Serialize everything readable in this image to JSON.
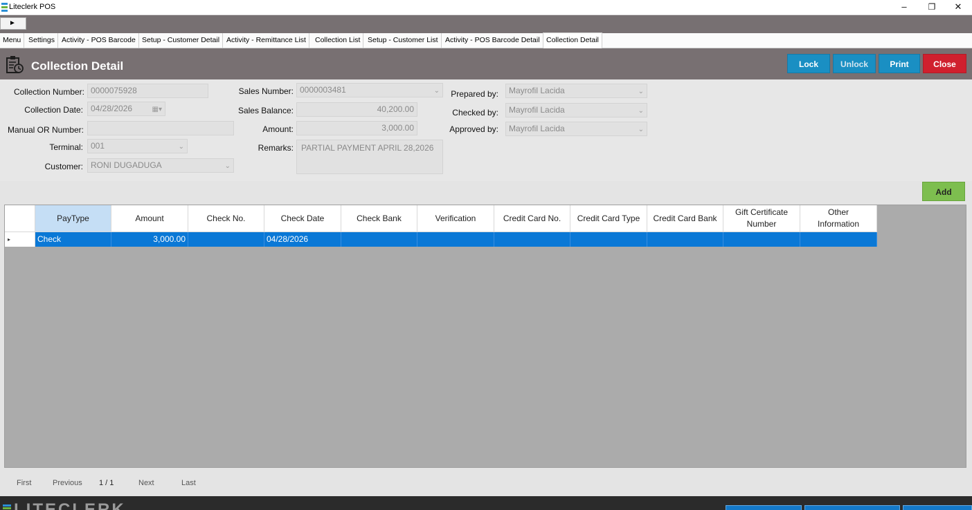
{
  "window": {
    "title": "Liteclerk POS",
    "minimize": "–",
    "restore": "❐",
    "close": "✕"
  },
  "menubar": {
    "toggle": "►"
  },
  "tabs": [
    "Menu",
    "Settings",
    "Activity - POS Barcode",
    "Setup - Customer Detail",
    "Activity - Remittance List",
    "Collection List",
    "Setup - Customer List",
    "Activity - POS Barcode Detail",
    "Collection Detail"
  ],
  "header": {
    "title": "Collection Detail",
    "lock": "Lock",
    "unlock": "Unlock",
    "print": "Print",
    "close": "Close"
  },
  "form": {
    "collection_number": {
      "label": "Collection Number:",
      "value": "0000075928"
    },
    "collection_date": {
      "label": "Collection Date:",
      "value": "04/28/2026"
    },
    "manual_or_number": {
      "label": "Manual OR Number:",
      "value": ""
    },
    "terminal": {
      "label": "Terminal:",
      "value": "001"
    },
    "customer": {
      "label": "Customer:",
      "value": "RONI DUGADUGA"
    },
    "sales_number": {
      "label": "Sales Number:",
      "value": "0000003481"
    },
    "sales_balance": {
      "label": "Sales Balance:",
      "value": "40,200.00"
    },
    "amount": {
      "label": "Amount:",
      "value": "3,000.00"
    },
    "remarks": {
      "label": "Remarks:",
      "value": "PARTIAL PAYMENT APRIL 28,2026"
    },
    "prepared_by": {
      "label": "Prepared by:",
      "value": "Mayrofil Lacida"
    },
    "checked_by": {
      "label": "Checked by:",
      "value": "Mayrofil Lacida"
    },
    "approved_by": {
      "label": "Approved by:",
      "value": "Mayrofil Lacida"
    }
  },
  "grid": {
    "add_label": "Add",
    "columns": [
      "PayType",
      "Amount",
      "Check No.",
      "Check Date",
      "Check Bank",
      "Verification",
      "Credit Card No.",
      "Credit Card Type",
      "Credit Card Bank",
      "Gift Certificate Number",
      "Other Information"
    ],
    "rows": [
      [
        "Check",
        "3,000.00",
        "",
        "04/28/2026",
        "",
        "",
        "",
        "",
        "",
        "",
        ""
      ]
    ],
    "row_marker": "▸"
  },
  "pager": {
    "first": "First",
    "previous": "Previous",
    "page": "1 / 1",
    "next": "Next",
    "last": "Last"
  },
  "footer": {
    "brand": "LITECLERK"
  },
  "colors": {
    "header_bg": "#787072",
    "lock": "#1a8fc3",
    "unlock": "#1a8fc3",
    "print": "#1a8fc3",
    "close": "#d0202e",
    "add": "#7dbe4f",
    "selected_row": "#0a78d6"
  }
}
